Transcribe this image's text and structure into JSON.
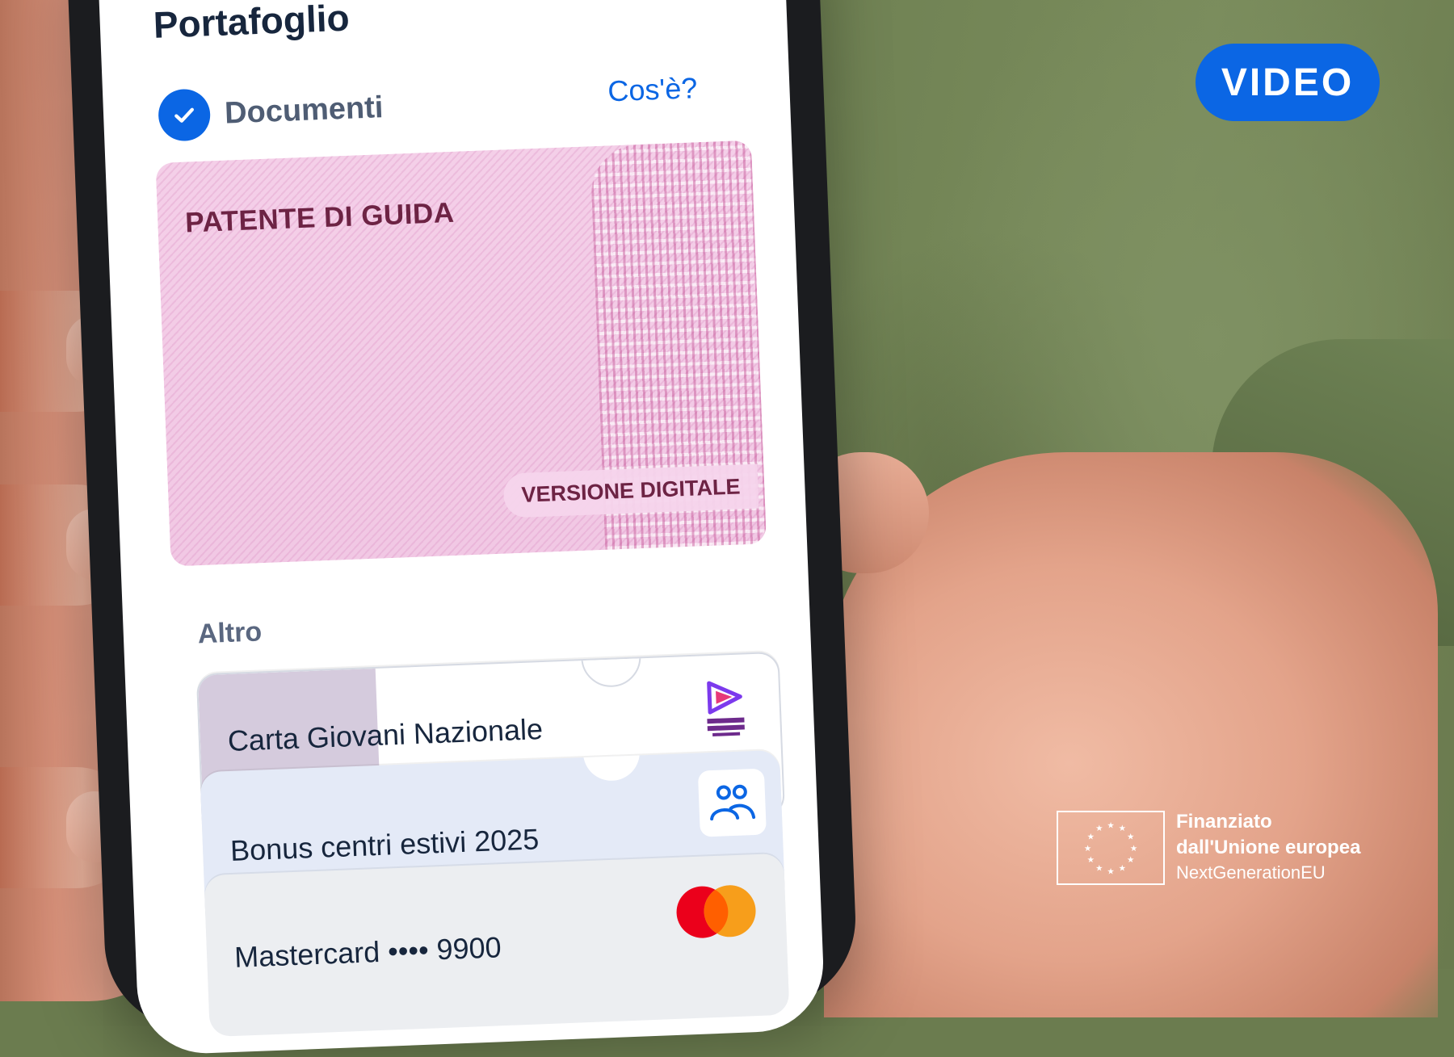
{
  "app": {
    "title": "Portafoglio"
  },
  "documents": {
    "section_title": "Documenti",
    "info_link": "Cos'è?",
    "license_card": {
      "title": "PATENTE DI GUIDA",
      "tag": "VERSIONE DIGITALE"
    }
  },
  "other": {
    "section_title": "Altro",
    "cards": [
      {
        "label": "Carta Giovani Nazionale",
        "logo_text": "CARTA GIOVANI NAZIONALE"
      },
      {
        "label": "Bonus centri estivi 2025",
        "icon": "people-icon"
      },
      {
        "label": "Mastercard •••• 9900",
        "icon": "mastercard-logo"
      }
    ]
  },
  "overlay": {
    "video_badge": "VIDEO",
    "eu_funding": {
      "line1": "Finanziato",
      "line2": "dall'Unione europea",
      "line3": "NextGenerationEU"
    }
  },
  "colors": {
    "accent": "#0b66e4",
    "license_pink": "#f2cbe6",
    "license_text": "#6d2344",
    "bonus_bg": "#e4eaf7"
  }
}
